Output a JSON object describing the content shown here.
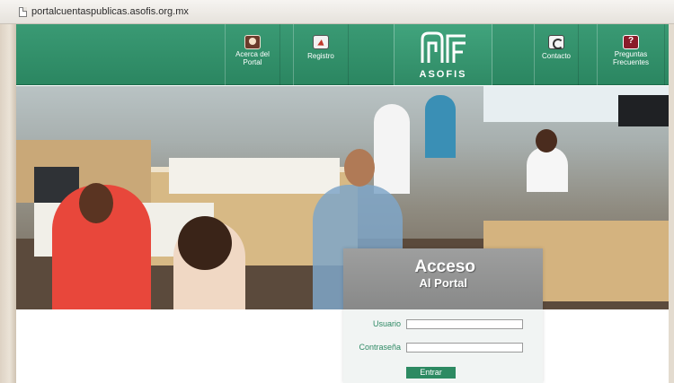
{
  "browser": {
    "url": "portalcuentaspublicas.asofis.org.mx"
  },
  "nav": {
    "items": [
      {
        "label": "Acerca del\nPortal",
        "icon": "people-icon"
      },
      {
        "label": "Registro",
        "icon": "cursor-arrow-icon"
      },
      {
        "label": "Contacto",
        "icon": "phone-icon"
      },
      {
        "label": "Preguntas\nFrecuentes",
        "icon": "question-chat-icon"
      }
    ],
    "logo_text": "ASOFIS"
  },
  "colors": {
    "brand_green": "#2b8661",
    "button_green": "#2d8a62",
    "label_green": "#2f8a65"
  },
  "login": {
    "title_line1": "Acceso",
    "title_line2": "Al Portal",
    "username_label": "Usuario",
    "username_value": "",
    "password_label": "Contraseña",
    "password_value": "",
    "submit_label": "Entrar"
  }
}
